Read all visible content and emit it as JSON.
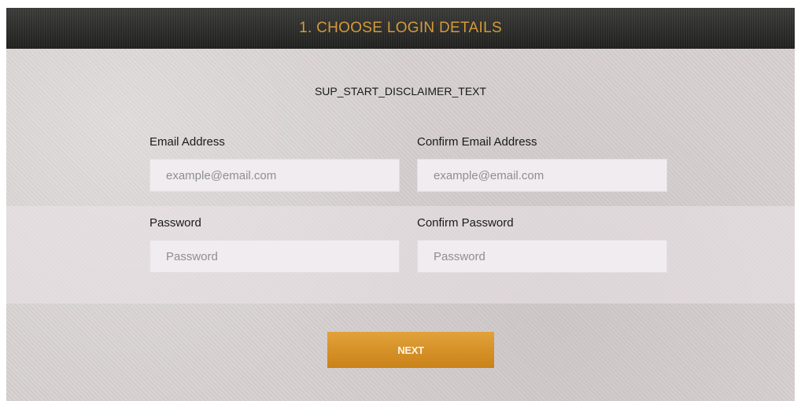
{
  "header": {
    "title": "1. CHOOSE LOGIN DETAILS"
  },
  "disclaimer": "SUP_START_DISCLAIMER_TEXT",
  "form": {
    "email": {
      "label": "Email Address",
      "placeholder": "example@email.com",
      "value": ""
    },
    "confirm_email": {
      "label": "Confirm Email Address",
      "placeholder": "example@email.com",
      "value": ""
    },
    "password": {
      "label": "Password",
      "placeholder": "Password",
      "value": ""
    },
    "confirm_password": {
      "label": "Confirm Password",
      "placeholder": "Password",
      "value": ""
    }
  },
  "next_button": {
    "label": "NEXT"
  },
  "colors": {
    "accent": "#d39b3a",
    "header_bg": "#2b2b2a",
    "button_bg": "#d6922a",
    "panel_bg": "#d7d1d1"
  }
}
